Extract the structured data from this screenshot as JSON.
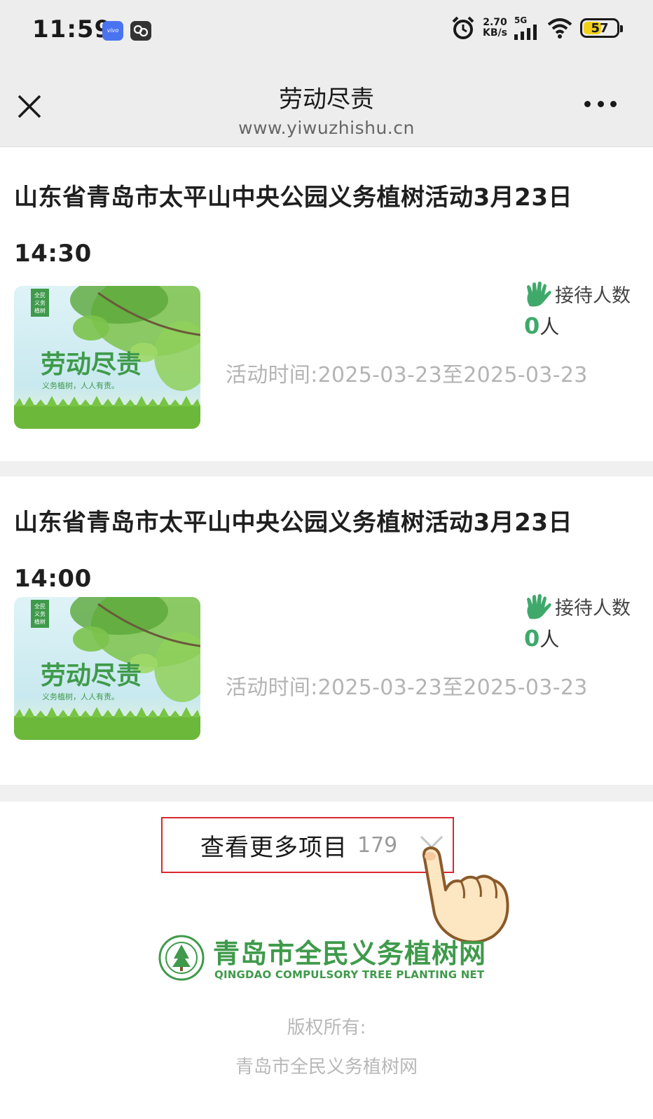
{
  "status_bar": {
    "time": "11:59",
    "vivo_badge": "vivo",
    "net_speed_value": "2.70",
    "net_speed_unit": "KB/s",
    "network": "5G",
    "battery": "57",
    "battery_level": 0.57,
    "icons": [
      "vivo-app-icon",
      "cloud-app-icon",
      "alarm-icon",
      "signal-icon",
      "wifi-icon",
      "battery-icon"
    ]
  },
  "nav": {
    "title": "劳动尽责",
    "url": "www.yiwuzhishu.cn",
    "close_icon": "close-icon",
    "more_icon": "more-icon"
  },
  "activities": [
    {
      "title_line1": "山东省青岛市太平山中央公园义务植树活动3月23日",
      "title_line2": "14:30",
      "thumb_badge": "全民义务植树",
      "thumb_title": "劳动尽责",
      "thumb_subtitle": "义务植树，人人有责。",
      "reception_label": "接待人数",
      "reception_count": "0",
      "reception_unit": "人",
      "time_text": "活动时间:2025-03-23至2025-03-23"
    },
    {
      "title_line1": "山东省青岛市太平山中央公园义务植树活动3月23日",
      "title_line2": "14:00",
      "thumb_badge": "全民义务植树",
      "thumb_title": "劳动尽责",
      "thumb_subtitle": "义务植树，人人有责。",
      "reception_label": "接待人数",
      "reception_count": "0",
      "reception_unit": "人",
      "time_text": "活动时间:2025-03-23至2025-03-23"
    }
  ],
  "more": {
    "label": "查看更多项目",
    "count": "179"
  },
  "footer": {
    "logo_cn": "青岛市全民义务植树网",
    "logo_en": "QINGDAO COMPULSORY TREE PLANTING NET",
    "copyright_label": "版权所有:",
    "copyright_owner": "青岛市全民义务植树网"
  },
  "colors": {
    "accent_green": "#3fa96b",
    "highlight_red": "#d9282f",
    "bar_bg": "#ededed"
  }
}
